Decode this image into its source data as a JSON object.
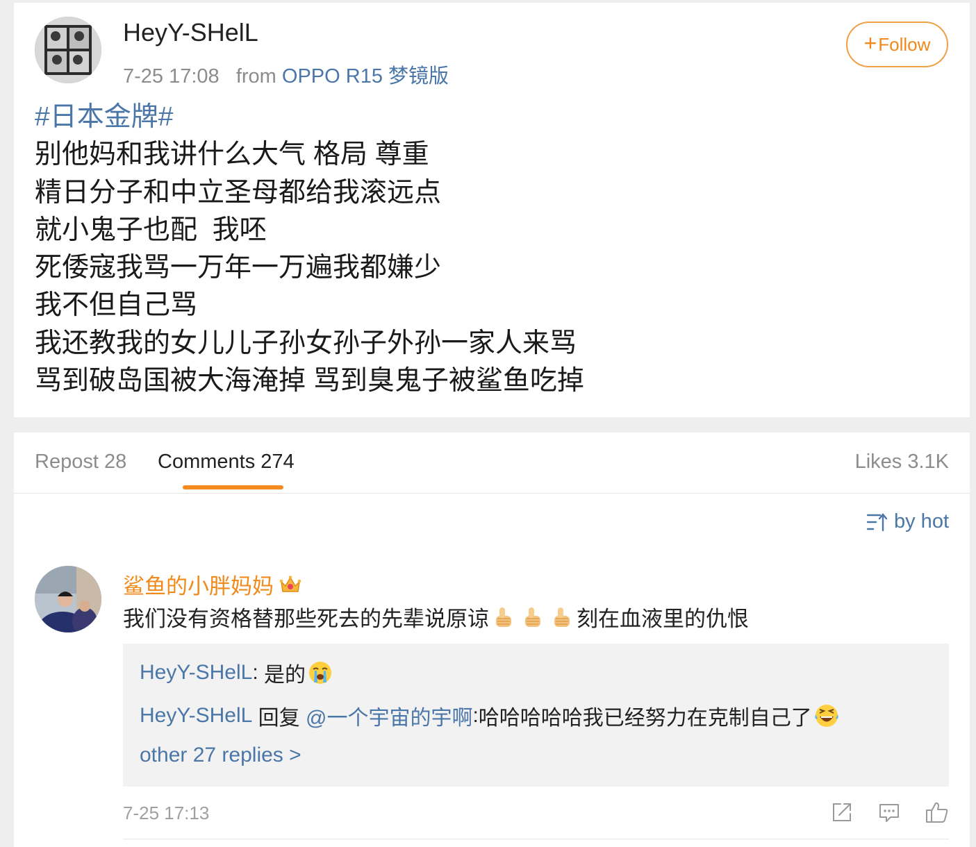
{
  "post": {
    "username": "HeyY-SHelL",
    "time": "7-25 17:08",
    "from_label": "from",
    "device": "OPPO R15 梦镜版",
    "follow_label": "Follow",
    "hashtag": "#日本金牌#",
    "lines": [
      "别他妈和我讲什么大气 格局 尊重",
      "精日分子和中立圣母都给我滚远点",
      "就小鬼子也配  我呸",
      "死倭寇我骂一万年一万遍我都嫌少",
      "我不但自己骂",
      "我还教我的女儿儿子孙女孙子外孙一家人来骂",
      "骂到破岛国被大海淹掉 骂到臭鬼子被鲨鱼吃掉"
    ]
  },
  "tabs": {
    "repost_label": "Repost",
    "repost_count": "28",
    "comments_label": "Comments",
    "comments_count": "274",
    "likes_label": "Likes",
    "likes_count": "3.1K"
  },
  "sort": {
    "label": "by hot"
  },
  "comment": {
    "username": "鲨鱼的小胖妈妈",
    "text_before": "我们没有资格替那些死去的先辈说原谅",
    "text_after": "刻在血液里的仇恨",
    "replies": [
      {
        "user": "HeyY-SHelL",
        "sep": ": ",
        "text": "是的"
      },
      {
        "user": "HeyY-SHelL",
        "mid": " 回复 ",
        "mention": "@一个宇宙的宇啊",
        "sep": ":",
        "text": "哈哈哈哈哈我已经努力在克制自己了"
      }
    ],
    "more_replies": "other 27 replies >",
    "time": "7-25 17:13"
  },
  "icons": {
    "follow": "plus-icon",
    "sort": "sort-icon",
    "crown": "crown-badge-icon",
    "thumb": "thumbs-up-emoji",
    "cry": "crying-emoji",
    "laugh": "laughing-emoji",
    "share": "share-icon",
    "reply": "comment-icon",
    "like": "like-icon"
  },
  "colors": {
    "accent": "#f08a1a",
    "link": "#4a76a8"
  }
}
